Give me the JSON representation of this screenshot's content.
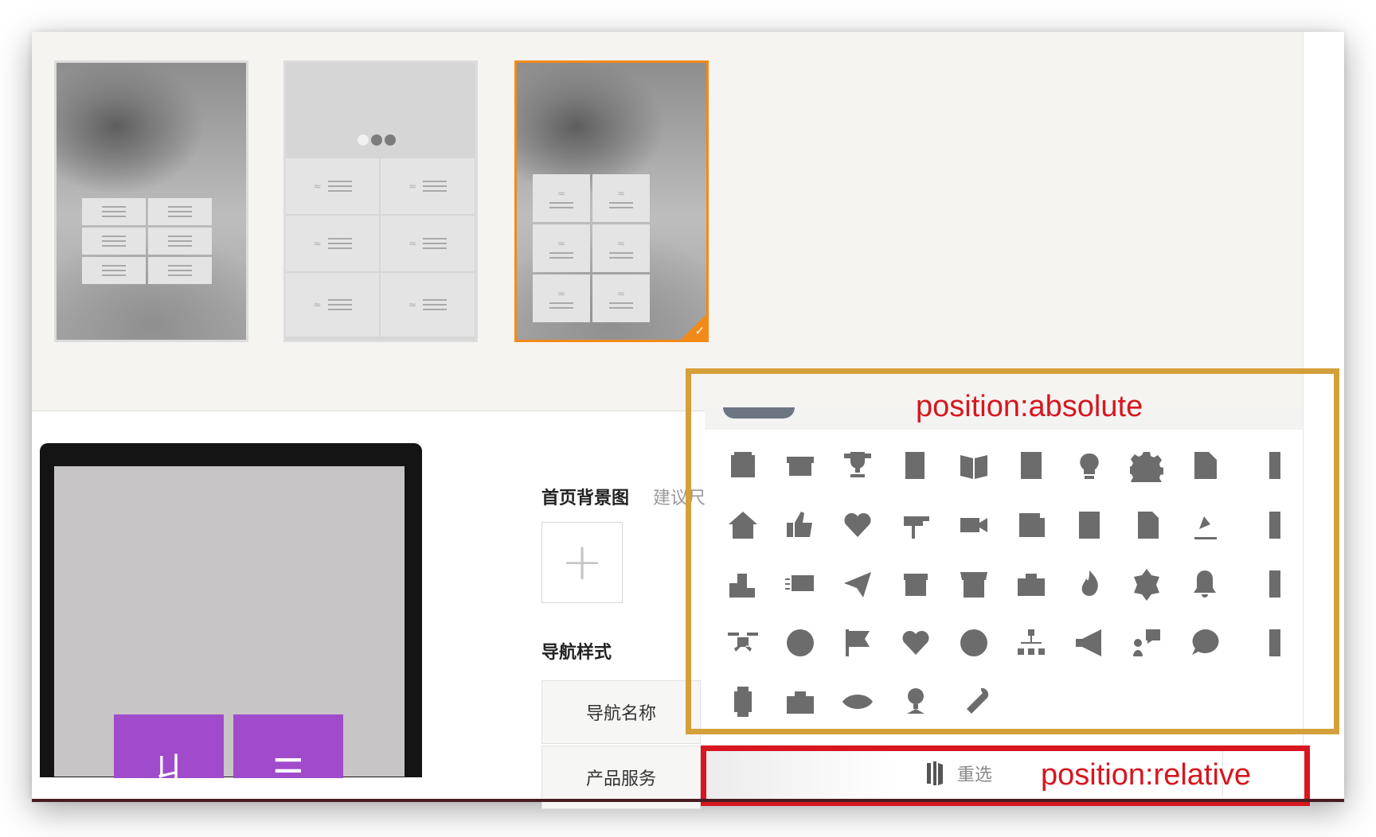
{
  "thumbnails": [
    {
      "id": "layout-1",
      "selected": false
    },
    {
      "id": "layout-2",
      "selected": false
    },
    {
      "id": "layout-3",
      "selected": true
    }
  ],
  "settings": {
    "bg_label": "首页背景图",
    "bg_hint": "建议尺",
    "upload_plus": "+",
    "nav_style_label": "导航样式",
    "nav_rows": [
      "导航名称",
      "产品服务"
    ],
    "reselect_label": "重选"
  },
  "phone_tiles": [
    {
      "icon": "bookmark-icon",
      "glyph": "ㄐ"
    },
    {
      "icon": "store-icon",
      "glyph": "☰"
    }
  ],
  "icon_picker": {
    "icons": [
      [
        "inbox-icon",
        "archive-icon",
        "trophy-icon",
        "bookmark-book-icon",
        "open-book-icon",
        "star-book-icon",
        "lightbulb-icon",
        "gear-icon",
        "document-icon",
        "partial-icon"
      ],
      [
        "home-icon",
        "thumbs-up-icon",
        "heart-icon",
        "mailbox-icon",
        "video-camera-icon",
        "newspaper-icon",
        "notepad-icon",
        "user-document-icon",
        "desk-lamp-icon",
        "partial-icon"
      ],
      [
        "podium-icon",
        "fast-mail-icon",
        "paper-plane-icon",
        "box-icon",
        "storefront-icon",
        "toolbox-icon",
        "fire-icon",
        "badge-icon",
        "bell-icon",
        "partial-icon"
      ],
      [
        "drone-icon",
        "smile-icon",
        "flag-icon",
        "heart-gift-icon",
        "lifebuoy-icon",
        "sitemap-icon",
        "megaphone-icon",
        "speaking-person-icon",
        "chat-bubble-icon",
        "partial-icon"
      ],
      [
        "smartwatch-icon",
        "briefcase-icon",
        "eye-icon",
        "webcam-icon",
        "wrench-icon"
      ]
    ]
  },
  "annotations": {
    "absolute_label": "position:absolute",
    "relative_label": "position:relative",
    "absolute_color": "#d4a03a",
    "relative_color": "#d7161f"
  },
  "colors": {
    "selected_border": "#f28a1a",
    "tile_purple": "#a04bcc",
    "icon_gray": "#6c6c6c"
  }
}
